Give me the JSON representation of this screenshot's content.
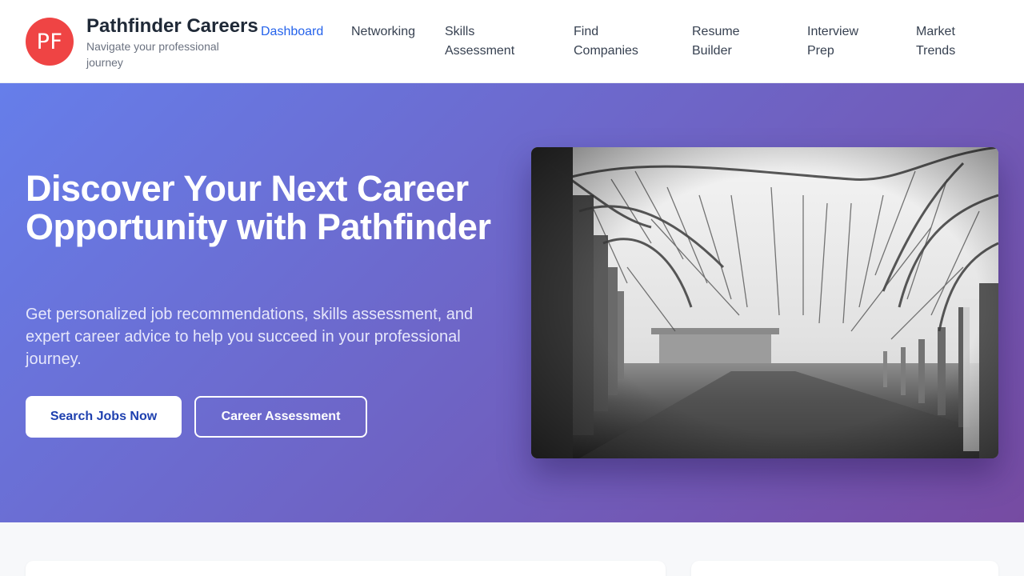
{
  "brand": {
    "logo_text": "PF",
    "name": "Pathfinder Careers",
    "tagline": "Navigate your professional journey"
  },
  "nav": {
    "items": [
      {
        "label": "Dashboard",
        "active": true
      },
      {
        "label": "Networking",
        "active": false
      },
      {
        "label": "Skills Assessment",
        "active": false
      },
      {
        "label": "Find Companies",
        "active": false
      },
      {
        "label": "Resume Builder",
        "active": false
      },
      {
        "label": "Interview Prep",
        "active": false
      },
      {
        "label": "Market Trends",
        "active": false
      }
    ]
  },
  "hero": {
    "title": "Discover Your Next Career Opportunity with Pathfinder",
    "subtitle": "Get personalized job recommendations, skills assessment, and expert career advice to help you succeed in your professional journey.",
    "primary_button": "Search Jobs Now",
    "secondary_button": "Career Assessment",
    "image": "black-and-white photo of an orchard row of bare trees"
  },
  "colors": {
    "logo_bg": "#ef4444",
    "active_nav": "#2563eb",
    "hero_gradient_start": "#667eea",
    "hero_gradient_end": "#764ba2",
    "primary_button_text": "#1e40af"
  }
}
